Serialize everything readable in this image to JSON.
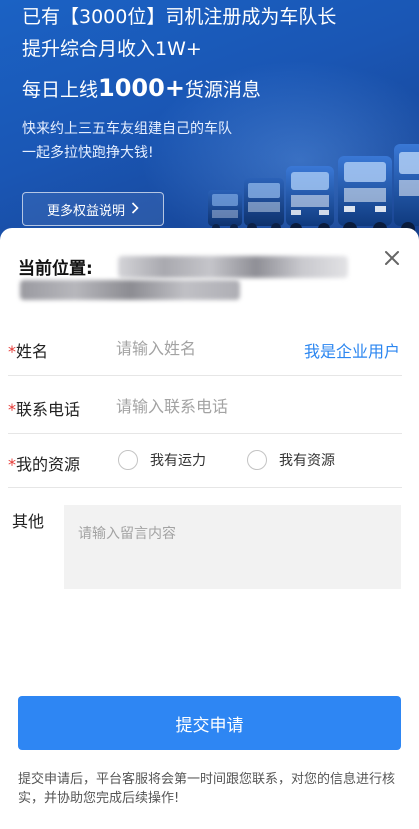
{
  "hero": {
    "line1": "已有【3000位】司机注册成为车队长",
    "line2": "提升综合月收入1W+",
    "line3_prefix": "每日上线",
    "line3_highlight": "1000+",
    "line3_suffix": "货源消息",
    "line4": "快来约上三五车友组建自己的车队",
    "line5": "一起多拉快跑挣大钱!",
    "benefits_button": "更多权益说明",
    "benefits_icon": "chevron-right-icon"
  },
  "location": {
    "label": "当前位置:"
  },
  "form": {
    "name": {
      "label": "姓名",
      "placeholder": "请输入姓名",
      "required_mark": "*"
    },
    "enterprise_link": "我是企业用户",
    "phone": {
      "label": "联系电话",
      "placeholder": "请输入联系电话",
      "required_mark": "*"
    },
    "resource": {
      "label": "我的资源",
      "required_mark": "*",
      "options": [
        "我有运力",
        "我有资源"
      ]
    },
    "other": {
      "label": "其他",
      "placeholder": "请输入留言内容"
    }
  },
  "submit_label": "提交申请",
  "note": "提交申请后，平台客服将会第一时间跟您联系，对您的信息进行核实，并协助您完成后续操作!",
  "colors": {
    "hero_blue": "#1a56b4",
    "accent_blue": "#2e86f3",
    "link_blue": "#2b86f0",
    "required_red": "#e53935"
  }
}
